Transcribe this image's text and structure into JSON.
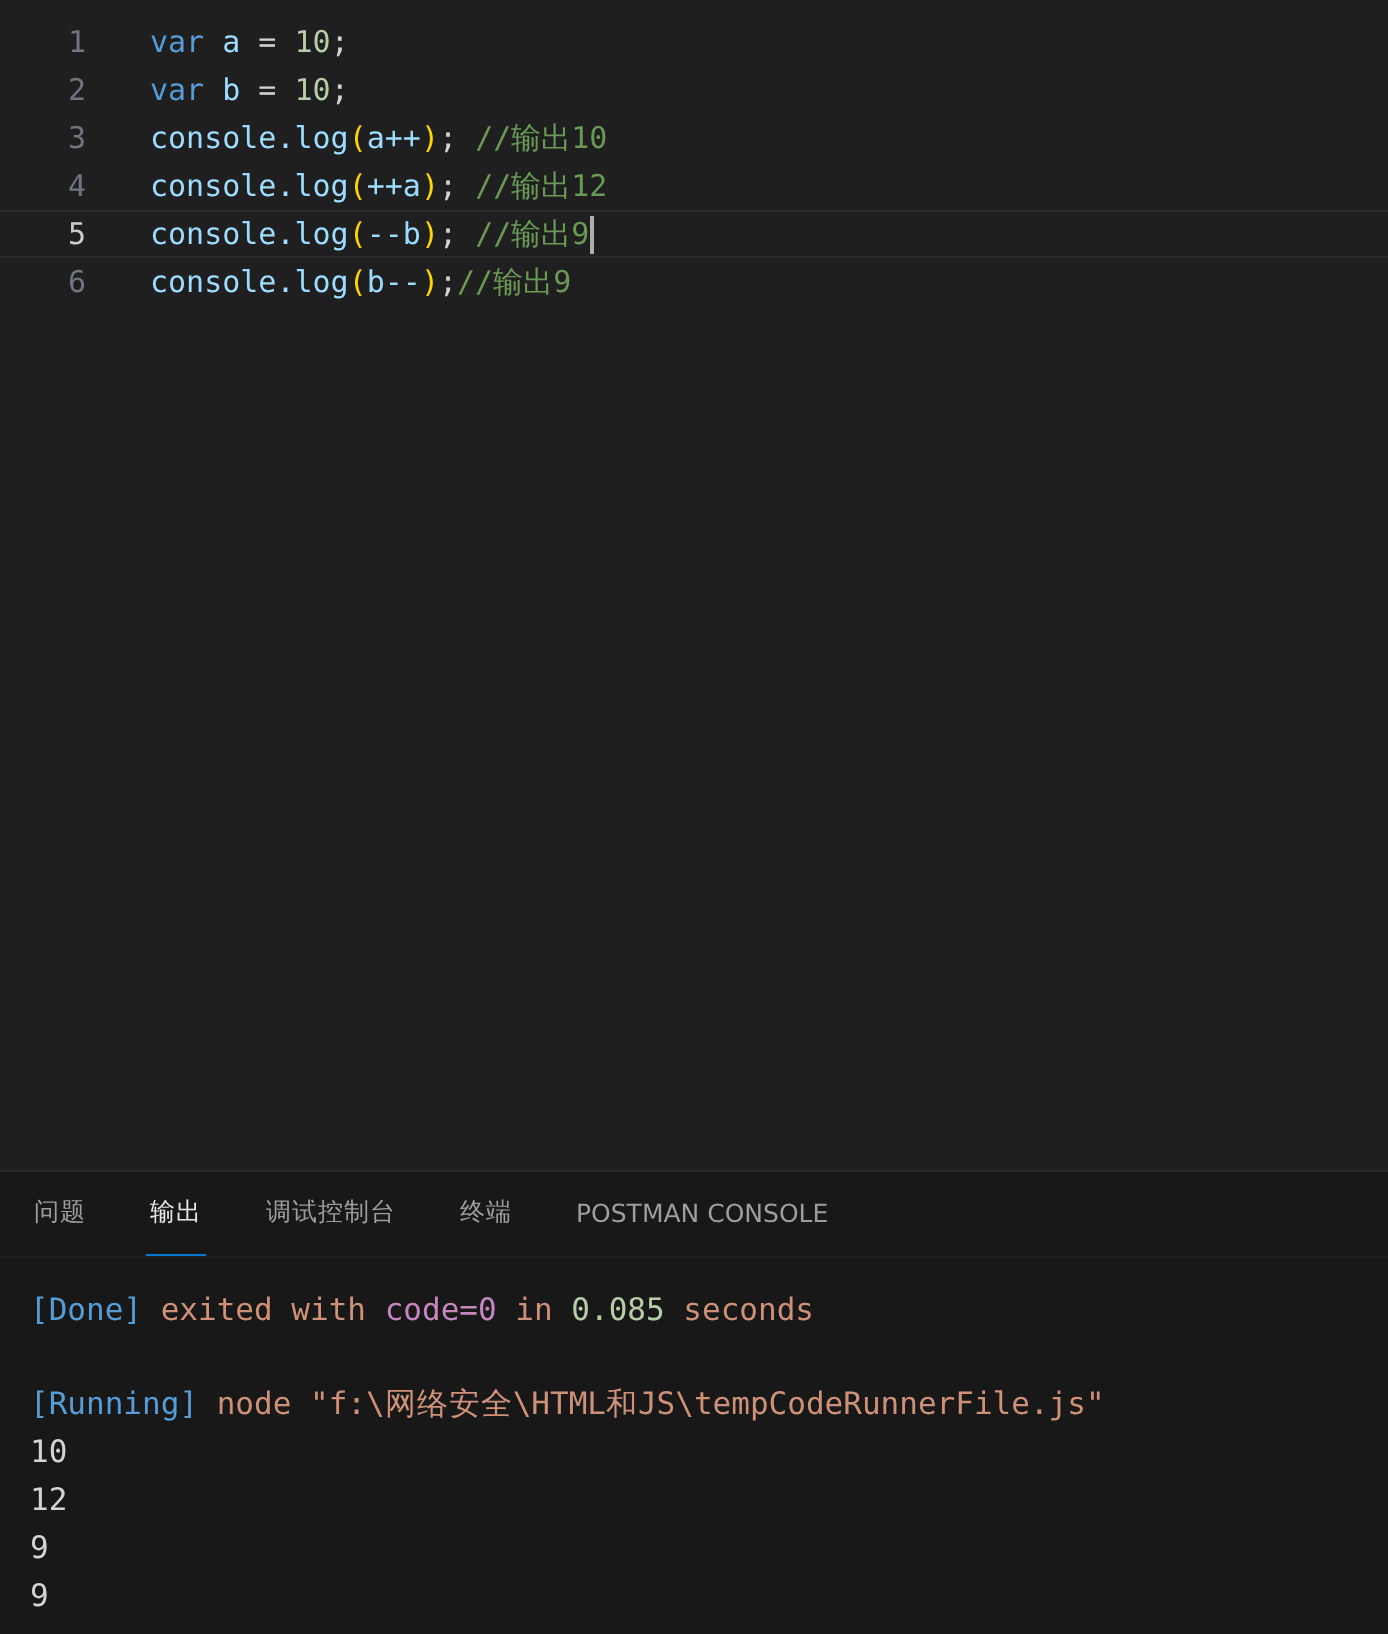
{
  "editor": {
    "lines": [
      {
        "number": "1",
        "current": false,
        "tokens": [
          {
            "kind": "keyword",
            "text": "var "
          },
          {
            "kind": "variable",
            "text": "a"
          },
          {
            "kind": "plain",
            "text": " = "
          },
          {
            "kind": "number",
            "text": "10"
          },
          {
            "kind": "plain",
            "text": ";"
          }
        ]
      },
      {
        "number": "2",
        "current": false,
        "tokens": [
          {
            "kind": "keyword",
            "text": "var "
          },
          {
            "kind": "variable",
            "text": "b"
          },
          {
            "kind": "plain",
            "text": " = "
          },
          {
            "kind": "number",
            "text": "10"
          },
          {
            "kind": "plain",
            "text": ";"
          }
        ]
      },
      {
        "number": "3",
        "current": false,
        "tokens": [
          {
            "kind": "variable",
            "text": "console.log"
          },
          {
            "kind": "paren",
            "text": "("
          },
          {
            "kind": "variable",
            "text": "a++"
          },
          {
            "kind": "paren",
            "text": ")"
          },
          {
            "kind": "plain",
            "text": "; "
          },
          {
            "kind": "comment",
            "text": "//输出10"
          }
        ]
      },
      {
        "number": "4",
        "current": false,
        "tokens": [
          {
            "kind": "variable",
            "text": "console.log"
          },
          {
            "kind": "paren",
            "text": "("
          },
          {
            "kind": "variable",
            "text": "++a"
          },
          {
            "kind": "paren",
            "text": ")"
          },
          {
            "kind": "plain",
            "text": "; "
          },
          {
            "kind": "comment",
            "text": "//输出12"
          }
        ]
      },
      {
        "number": "5",
        "current": true,
        "tokens": [
          {
            "kind": "variable",
            "text": "console.log"
          },
          {
            "kind": "paren",
            "text": "("
          },
          {
            "kind": "variable",
            "text": "--b"
          },
          {
            "kind": "paren",
            "text": ")"
          },
          {
            "kind": "plain",
            "text": "; "
          },
          {
            "kind": "comment",
            "text": "//输出9"
          }
        ]
      },
      {
        "number": "6",
        "current": false,
        "tokens": [
          {
            "kind": "variable",
            "text": "console.log"
          },
          {
            "kind": "paren",
            "text": "("
          },
          {
            "kind": "variable",
            "text": "b--"
          },
          {
            "kind": "paren",
            "text": ")"
          },
          {
            "kind": "plain",
            "text": ";"
          },
          {
            "kind": "comment",
            "text": "//输出9"
          }
        ]
      }
    ]
  },
  "panel": {
    "tabs": [
      {
        "label": "问题",
        "selected": false
      },
      {
        "label": "输出",
        "selected": true
      },
      {
        "label": "调试控制台",
        "selected": false
      },
      {
        "label": "终端",
        "selected": false
      },
      {
        "label": "POSTMAN CONSOLE",
        "selected": false
      }
    ],
    "output": [
      {
        "lines": [
          [
            {
              "kind": "tag",
              "text": "[Done]"
            },
            {
              "kind": "string",
              "text": " exited with "
            },
            {
              "kind": "key",
              "text": "code=0"
            },
            {
              "kind": "string",
              "text": " in "
            },
            {
              "kind": "number",
              "text": "0.085"
            },
            {
              "kind": "string",
              "text": " seconds"
            }
          ]
        ]
      },
      {
        "lines": [
          [
            {
              "kind": "tag",
              "text": "[Running]"
            },
            {
              "kind": "string",
              "text": " node \"f:\\网络安全\\HTML和JS\\tempCodeRunnerFile.js\""
            }
          ],
          [
            {
              "kind": "plain",
              "text": "10"
            }
          ],
          [
            {
              "kind": "plain",
              "text": "12"
            }
          ],
          [
            {
              "kind": "plain",
              "text": "9"
            }
          ],
          [
            {
              "kind": "plain",
              "text": "9"
            }
          ]
        ]
      }
    ]
  }
}
